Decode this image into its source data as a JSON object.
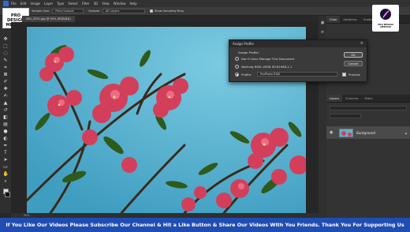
{
  "menu": {
    "items": [
      "File",
      "Edit",
      "Image",
      "Layer",
      "Type",
      "Select",
      "Filter",
      "3D",
      "View",
      "Window",
      "Help"
    ]
  },
  "options": {
    "sample_size_label": "Sample Size:",
    "sample_size_value": "Point Sample",
    "sample_label": "Sample:",
    "sample_value": "All Layers",
    "show_ring_label": "Show Sampling Ring"
  },
  "badge": {
    "line1": "PRO DESIGN",
    "line2": "MENTOR"
  },
  "document": {
    "tab": "IMG_2521.jpg @ 50% (RGB/8#)",
    "status": "50%"
  },
  "right_panels": {
    "top_tabs": [
      "Color",
      "Swatches",
      "Gradients",
      "Patterns"
    ],
    "layers_tabs": [
      "Layers",
      "Channels",
      "Paths"
    ],
    "layer_name": "Background"
  },
  "channel_logo": {
    "line1": "PRO DESIGN",
    "line2": "MENTOR"
  },
  "dialog": {
    "title": "Assign Profile",
    "assign_label": "Assign Profile:",
    "option1": "Don't Color Manage This Document",
    "option2": "Working RGB:  sRGB IEC61966-2.1",
    "option3_label": "Profile:",
    "profile_value": "ProPhoto RGB",
    "ok": "OK",
    "cancel": "Cancel",
    "preview": "Preview",
    "selected_option": "profile"
  },
  "banner": {
    "text": "If You Like Our Videos Please Subscribe Our Channel & Hit a Like Button & Share Our Videos With You Friends. Thank You For Supporting Us"
  },
  "colors": {
    "banner": "#1f4db3",
    "sky": "#5fb3cf",
    "flower": "#d33f5a",
    "leaf": "#2e5a1c"
  }
}
